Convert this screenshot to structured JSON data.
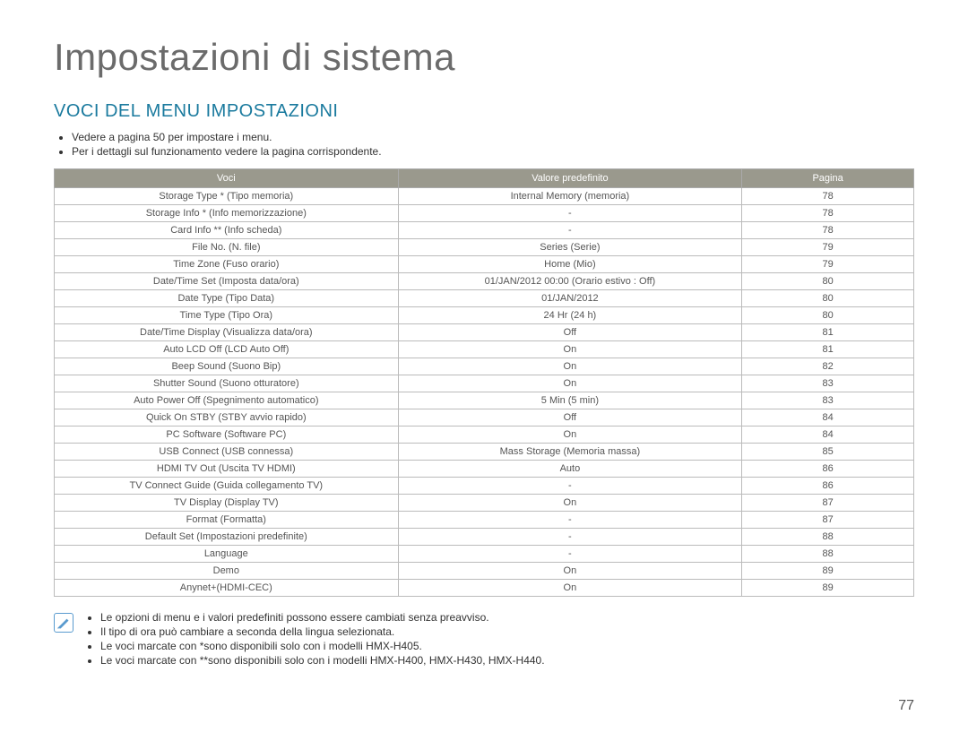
{
  "main_title": "Impostazioni di sistema",
  "section_title": "VOCI DEL MENU IMPOSTAZIONI",
  "intro_bullets": [
    "Vedere a pagina 50 per impostare i menu.",
    "Per i dettagli sul funzionamento vedere la pagina corrispondente."
  ],
  "table": {
    "headers": [
      "Voci",
      "Valore predefinito",
      "Pagina"
    ],
    "rows": [
      [
        "Storage Type * (Tipo memoria)",
        "Internal Memory (memoria)",
        "78"
      ],
      [
        "Storage Info * (Info memorizzazione)",
        "-",
        "78"
      ],
      [
        "Card Info ** (Info scheda)",
        "-",
        "78"
      ],
      [
        "File No. (N. file)",
        "Series (Serie)",
        "79"
      ],
      [
        "Time Zone (Fuso orario)",
        "Home (Mio)",
        "79"
      ],
      [
        "Date/Time Set (Imposta data/ora)",
        "01/JAN/2012 00:00 (Orario estivo : Off)",
        "80"
      ],
      [
        "Date Type (Tipo Data)",
        "01/JAN/2012",
        "80"
      ],
      [
        "Time Type (Tipo Ora)",
        "24 Hr (24 h)",
        "80"
      ],
      [
        "Date/Time Display (Visualizza data/ora)",
        "Off",
        "81"
      ],
      [
        "Auto LCD Off (LCD Auto Off)",
        "On",
        "81"
      ],
      [
        "Beep Sound (Suono Bip)",
        "On",
        "82"
      ],
      [
        "Shutter Sound (Suono otturatore)",
        "On",
        "83"
      ],
      [
        "Auto Power Off (Spegnimento automatico)",
        "5 Min (5 min)",
        "83"
      ],
      [
        "Quick On STBY (STBY avvio rapido)",
        "Off",
        "84"
      ],
      [
        "PC Software (Software PC)",
        "On",
        "84"
      ],
      [
        "USB Connect (USB connessa)",
        "Mass Storage (Memoria massa)",
        "85"
      ],
      [
        "HDMI TV Out (Uscita TV HDMI)",
        "Auto",
        "86"
      ],
      [
        "TV Connect Guide (Guida collegamento TV)",
        "-",
        "86"
      ],
      [
        "TV Display (Display TV)",
        "On",
        "87"
      ],
      [
        "Format (Formatta)",
        "-",
        "87"
      ],
      [
        "Default Set (Impostazioni predefinite)",
        "-",
        "88"
      ],
      [
        "Language",
        "-",
        "88"
      ],
      [
        "Demo",
        "On",
        "89"
      ],
      [
        "Anynet+(HDMI-CEC)",
        "On",
        "89"
      ]
    ]
  },
  "notes": [
    "Le opzioni di menu e i valori predefiniti possono essere cambiati senza preavviso.",
    "Il tipo di ora può cambiare a seconda della lingua selezionata.",
    "Le voci marcate con *sono disponibili solo con i modelli HMX-H405.",
    "Le voci marcate con **sono disponibili solo con i modelli HMX-H400, HMX-H430, HMX-H440."
  ],
  "page_number": "77"
}
